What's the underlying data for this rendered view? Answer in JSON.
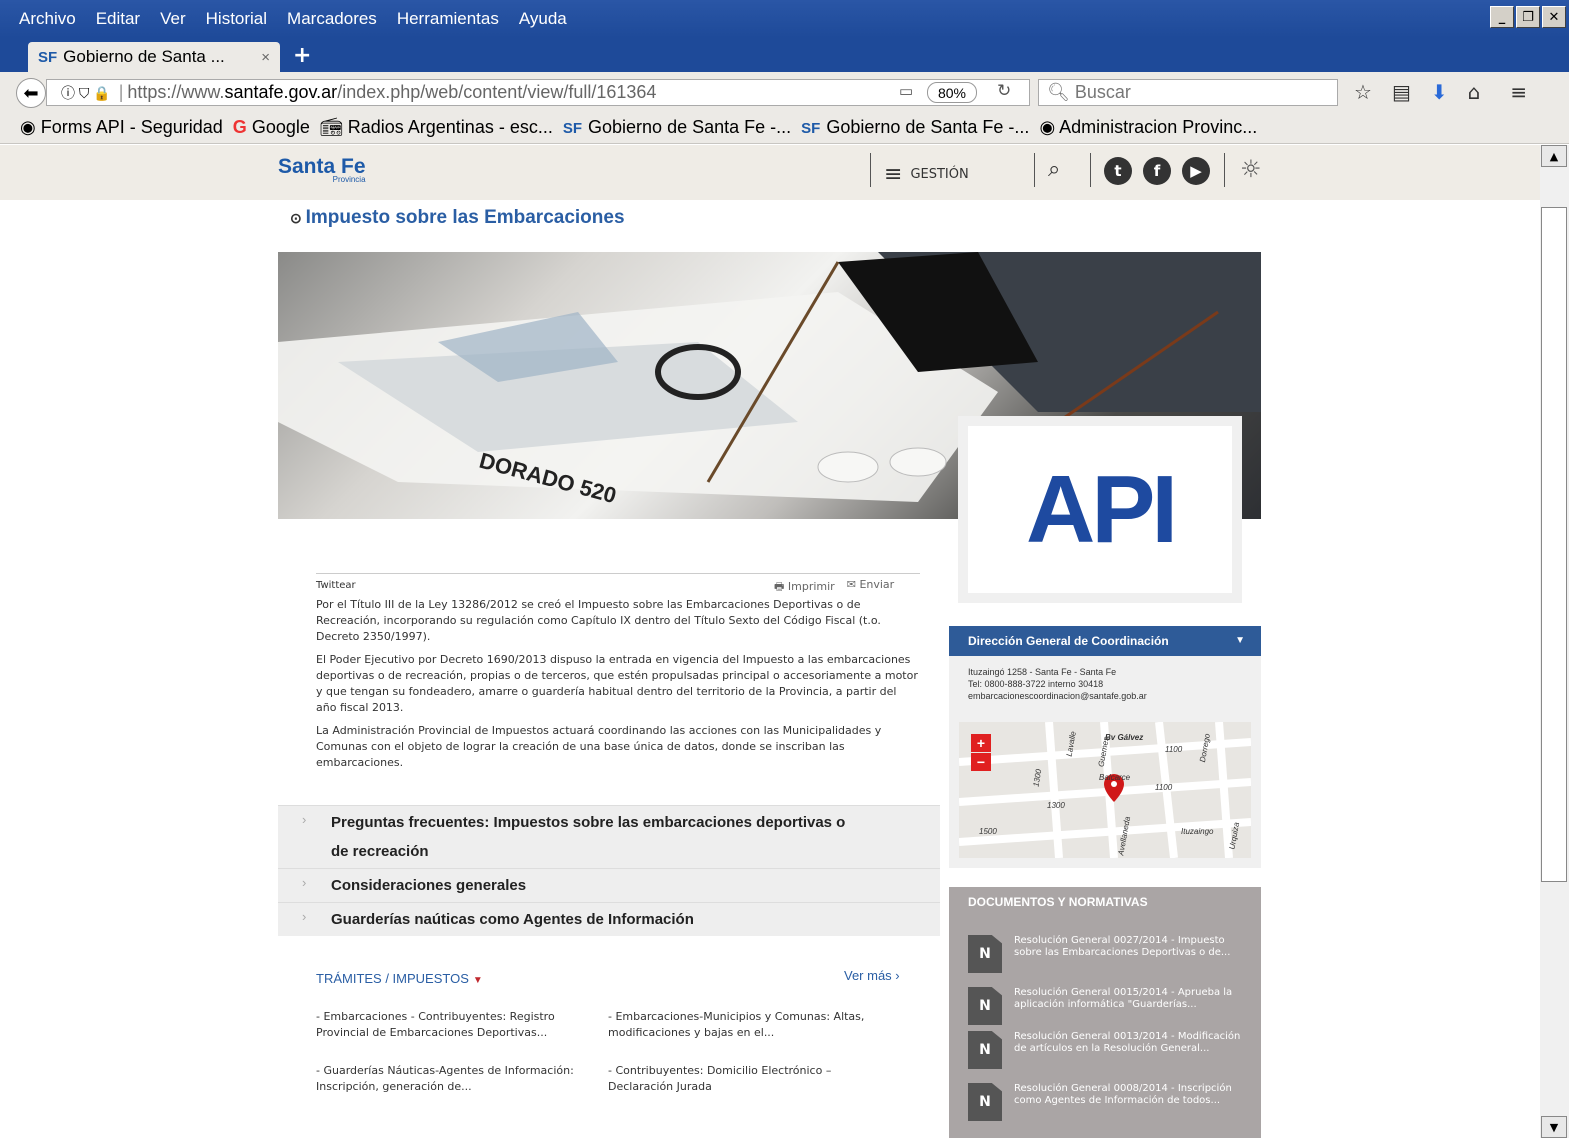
{
  "menu": [
    "Archivo",
    "Editar",
    "Ver",
    "Historial",
    "Marcadores",
    "Herramientas",
    "Ayuda"
  ],
  "tab": {
    "icon": "SF",
    "title": "Gobierno de Santa ...",
    "close": "×",
    "new": "+"
  },
  "url": {
    "proto": "https://www.",
    "domain": "santafe.gov.ar",
    "path": "/index.php/web/content/view/full/161364",
    "zoom": "80%"
  },
  "search_placeholder": "Buscar",
  "bookmarks": [
    {
      "icon": "globe",
      "label": "Forms API - Seguridad"
    },
    {
      "icon": "G",
      "label": "Google"
    },
    {
      "icon": "radio",
      "label": "Radios Argentinas - esc..."
    },
    {
      "icon": "SF",
      "label": "Gobierno de Santa Fe -..."
    },
    {
      "icon": "SF",
      "label": "Gobierno de Santa Fe -..."
    },
    {
      "icon": "globe",
      "label": "Administracion Provinc..."
    }
  ],
  "site": {
    "logo": "Santa Fe",
    "logo_sub": "Provincia",
    "menu_label": "GESTIÓN"
  },
  "page_title": "Impuesto sobre las Embarcaciones",
  "hero_logo": "API",
  "share": {
    "twitter": "Twittear",
    "print": "Imprimir",
    "send": "Enviar"
  },
  "paragraphs": [
    "Por el Título III de la Ley 13286/2012 se creó el Impuesto sobre las Embarcaciones Deportivas o de Recreación, incorporando su regulación como Capítulo IX dentro del Título Sexto del Código Fiscal (t.o. Decreto 2350/1997).",
    "El Poder Ejecutivo por Decreto 1690/2013 dispuso la entrada en vigencia del Impuesto a las embarcaciones deportivas o de recreación, propias o de terceros, que estén propulsadas principal o accesoriamente a motor y que tengan su fondeadero, amarre o guardería habitual dentro del territorio de la Provincia, a partir del año fiscal 2013.",
    "La Administración Provincial de Impuestos actuará coordinando las acciones con las Municipalidades y Comunas con el objeto de lograr la creación de una base única de datos, donde se inscriban las embarcaciones."
  ],
  "accordion": [
    "Preguntas frecuentes: Impuestos sobre las embarcaciones deportivas o de recreación",
    "Consideraciones generales",
    "Guarderías naúticas como Agentes de Información"
  ],
  "tramites": {
    "title": "TRÁMITES / IMPUESTOS",
    "more": "Ver más ›",
    "items": [
      "- Embarcaciones - Contribuyentes: Registro Provincial de Embarcaciones Deportivas...",
      "- Embarcaciones-Municipios y Comunas: Altas, modificaciones y bajas en el...",
      "- Guarderías Náuticas-Agentes de Información: Inscripción, generación de...",
      "- Contribuyentes: Domicilio Electrónico – Declaración Jurada"
    ]
  },
  "sidebar": {
    "title": "Dirección General de Coordinación",
    "address": "Ituzaingó 1258 - Santa Fe - Santa Fe",
    "tel": "Tel: 0800-888-3722 interno 30418",
    "email": "embarcacionescoordinacion@santafe.gob.ar"
  },
  "map_labels": [
    "Bv Gálvez",
    "1100",
    "Balcarce",
    "1100",
    "1300",
    "1300",
    "1500",
    "Lavalle",
    "Guemes",
    "Dorrego",
    "Avellaneda",
    "Ituzaingo",
    "Urquiza"
  ],
  "docs": {
    "title": "DOCUMENTOS Y NORMATIVAS",
    "items": [
      "Resolución General 0027/2014 - Impuesto sobre las Embarcaciones Deportivas o de...",
      "Resolución General 0015/2014 - Aprueba la aplicación informática \"Guarderías...",
      "Resolución General 0013/2014 - Modificación de artículos en la Resolución General...",
      "Resolución General 0008/2014 - Inscripción como Agentes de Información de todos..."
    ]
  }
}
